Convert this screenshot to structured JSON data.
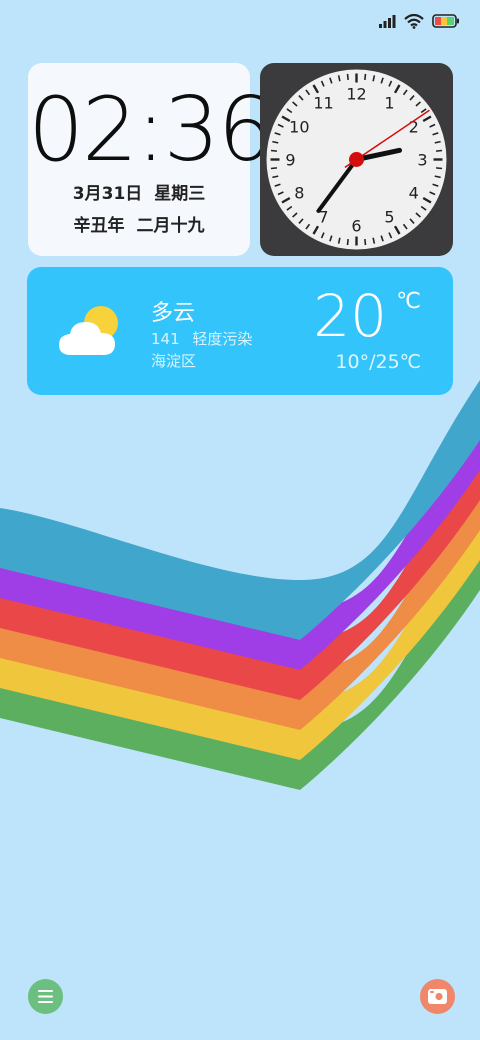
{
  "status_bar": {
    "icons": [
      "signal-icon",
      "wifi-icon",
      "battery-icon"
    ]
  },
  "digital_clock": {
    "time": "02:36",
    "date": "3月31日",
    "weekday": "星期三",
    "lunar_year": "辛丑年",
    "lunar_date": "二月十九"
  },
  "analog_clock": {
    "numerals": [
      "12",
      "1",
      "2",
      "3",
      "4",
      "5",
      "6",
      "7",
      "8",
      "9",
      "10",
      "11"
    ],
    "hour": 2,
    "minute": 36,
    "second": 5,
    "colors": {
      "face": "#f0f0f0",
      "hands": "#111111",
      "second_hand": "#d40d0d",
      "background": "#3b3b3d"
    }
  },
  "weather": {
    "condition": "多云",
    "aqi_value": "141",
    "aqi_label": "轻度污染",
    "location": "海淀区",
    "temperature": "20",
    "unit": "℃",
    "range": "10°/25℃",
    "icon": "partly-cloudy-icon",
    "background_color": "#33c4fb"
  },
  "dock": {
    "left_icon": "menu-icon",
    "right_icon": "camera-icon"
  },
  "wallpaper": {
    "background": "#bee4fb",
    "stripe_colors": [
      "#40a6cb",
      "#9f3ee6",
      "#ea4848",
      "#ef8d47",
      "#f0c63d",
      "#5caf5f"
    ]
  }
}
